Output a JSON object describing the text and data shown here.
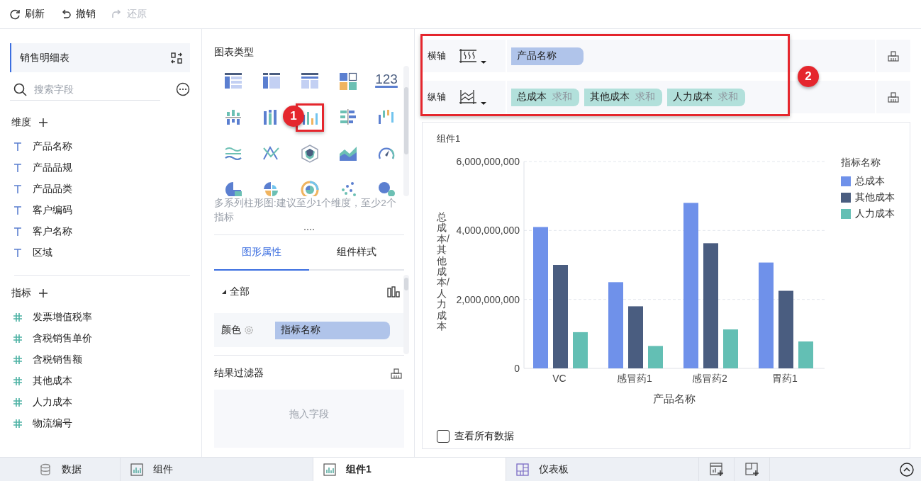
{
  "toolbar": [
    {
      "label": "刷新",
      "kind": "refresh",
      "disabled": false
    },
    {
      "label": "撤销",
      "kind": "undo",
      "disabled": false
    },
    {
      "label": "还原",
      "kind": "redo",
      "disabled": true
    }
  ],
  "dataset": {
    "name": "销售明细表",
    "search_placeholder": "搜索字段"
  },
  "dimensions": {
    "title": "维度",
    "fields": [
      "产品名称",
      "产品品规",
      "产品品类",
      "客户编码",
      "客户名称",
      "区域"
    ]
  },
  "measures": {
    "title": "指标",
    "fields": [
      "发票增值税率",
      "含税销售单价",
      "含税销售额",
      "其他成本",
      "人力成本",
      "物流编号"
    ]
  },
  "chart_types": {
    "title": "图表类型",
    "items": [
      {
        "kind": "table-detail",
        "selected": false
      },
      {
        "kind": "table-cross",
        "selected": false
      },
      {
        "kind": "table-group",
        "selected": false
      },
      {
        "kind": "tiles",
        "selected": false
      },
      {
        "kind": "number",
        "text": "123",
        "selected": false
      },
      {
        "kind": "bar-center",
        "selected": false
      },
      {
        "kind": "bar-stack",
        "selected": false
      },
      {
        "kind": "bar-multi",
        "selected": true
      },
      {
        "kind": "bar-h",
        "selected": false
      },
      {
        "kind": "bar-range",
        "selected": false
      },
      {
        "kind": "line-wave",
        "selected": false
      },
      {
        "kind": "line-cross",
        "selected": false
      },
      {
        "kind": "radar",
        "selected": false
      },
      {
        "kind": "area",
        "selected": false
      },
      {
        "kind": "gauge",
        "selected": false
      },
      {
        "kind": "pie",
        "selected": false
      },
      {
        "kind": "rose",
        "selected": false
      },
      {
        "kind": "sunburst",
        "selected": false
      },
      {
        "kind": "scatter",
        "selected": false
      },
      {
        "kind": "bubble",
        "selected": false
      }
    ],
    "hint": "多系列柱形图:建议至少1个维度，至少2个指标"
  },
  "property_tabs": [
    {
      "label": "图形属性",
      "selected": true
    },
    {
      "label": "组件样式",
      "selected": false
    }
  ],
  "properties": {
    "group": "全部",
    "expanded": true,
    "color_label": "颜色",
    "color_field": "指标名称"
  },
  "result_filter": {
    "title": "结果过滤器",
    "placeholder": "拖入字段"
  },
  "axes": [
    {
      "label": "横轴",
      "kind": "x",
      "fields": [
        {
          "name": "产品名称"
        }
      ]
    },
    {
      "label": "纵轴",
      "kind": "y",
      "fields": [
        {
          "name": "总成本",
          "agg": "求和"
        },
        {
          "name": "其他成本",
          "agg": "求和"
        },
        {
          "name": "人力成本",
          "agg": "求和"
        }
      ]
    }
  ],
  "callouts": [
    {
      "label": "1"
    },
    {
      "label": "2"
    }
  ],
  "component": {
    "title": "组件1",
    "show_all_label": "查看所有数据",
    "show_all": false,
    "chart_data": {
      "type": "bar",
      "xlabel": "产品名称",
      "ylabel": "总成本/其他成本/人力成本",
      "legend_title": "指标名称",
      "categories": [
        "VC",
        "感冒药1",
        "感冒药2",
        "胃药1"
      ],
      "series": [
        {
          "name": "总成本",
          "color": "#6f91ea",
          "values": [
            4100000000,
            2500000000,
            4800000000,
            3070000000
          ]
        },
        {
          "name": "其他成本",
          "color": "#4a5d80",
          "values": [
            3000000000,
            1800000000,
            3630000000,
            2250000000
          ]
        },
        {
          "name": "人力成本",
          "color": "#63bfb4",
          "values": [
            1050000000,
            650000000,
            1130000000,
            780000000
          ]
        }
      ],
      "ylim": [
        0,
        6000000000
      ],
      "yticks": [
        {
          "value": 0,
          "label": "0"
        },
        {
          "value": 2000000000,
          "label": "2,000,000,000"
        },
        {
          "value": 4000000000,
          "label": "4,000,000,000"
        },
        {
          "value": 6000000000,
          "label": "6,000,000,000"
        }
      ]
    }
  },
  "bottom_tabs": [
    {
      "label": "数据",
      "kind": "data",
      "selected": false
    },
    {
      "label": "组件",
      "kind": "chart",
      "selected": false
    },
    {
      "label": "组件1",
      "kind": "chart",
      "selected": true
    },
    {
      "label": "仪表板",
      "kind": "dashboard",
      "selected": false
    }
  ]
}
